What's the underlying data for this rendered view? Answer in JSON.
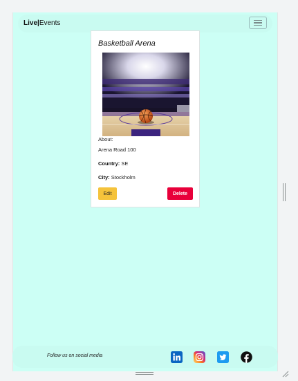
{
  "navbar": {
    "brand_bold": "Live",
    "brand_separator": "|",
    "brand_rest": "Events",
    "menu_icon": "hamburger-icon"
  },
  "venue": {
    "name": "Basketball Arena",
    "image_alt": "Basketball on arena court",
    "about_label": "About:",
    "about_value": "Arena Road 100",
    "country_label": "Country:",
    "country_value": "SE",
    "city_label": "City:",
    "city_value": "Stockholm"
  },
  "actions": {
    "edit_label": "Edit",
    "delete_label": "Delete"
  },
  "footer": {
    "text": "Follow us on social media",
    "icons": [
      "linkedin-icon",
      "instagram-icon",
      "twitter-icon",
      "facebook-icon"
    ]
  },
  "colors": {
    "background": "#ccfff5",
    "navbar": "#c9fbf1",
    "edit_button": "#f5c33b",
    "delete_button": "#e8003a"
  }
}
